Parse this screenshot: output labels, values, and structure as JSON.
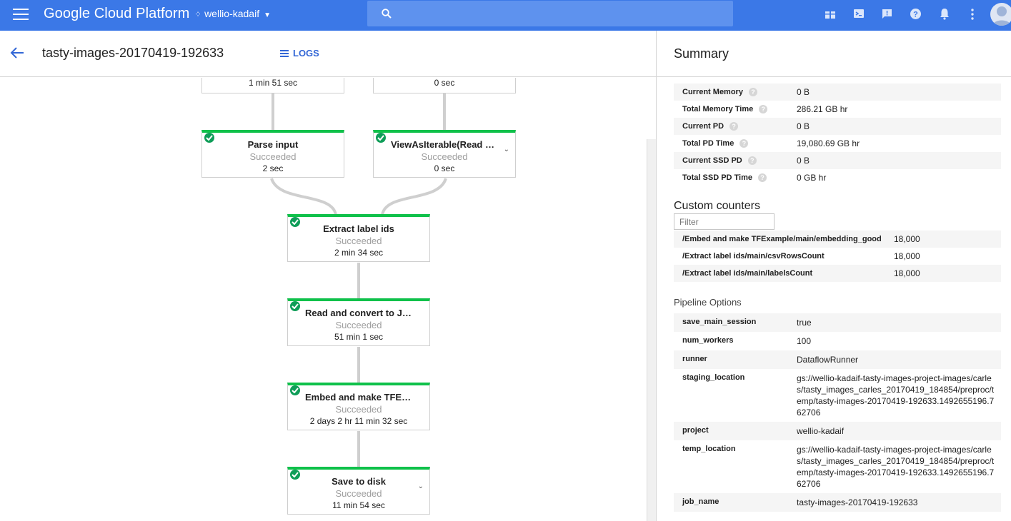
{
  "topbar": {
    "brand": "Google Cloud Platform",
    "project": "wellio-kadaif",
    "icons": [
      "gift-icon",
      "terminal-icon",
      "feedback-icon",
      "help-icon",
      "notifications-icon",
      "more-vert-icon",
      "account-avatar"
    ],
    "colors": {
      "bar": "#3b78e7",
      "search": "#5e92ee"
    }
  },
  "header": {
    "job_name": "tasty-images-20170419-192633",
    "logs_label": "LOGS"
  },
  "graph": {
    "nodes": [
      {
        "name": "",
        "status": "",
        "time": "1 min 51 sec"
      },
      {
        "name": "",
        "status": "",
        "time": "0 sec"
      },
      {
        "name": "Parse input",
        "status": "Succeeded",
        "time": "2 sec"
      },
      {
        "name": "ViewAsIterable(Read di…",
        "status": "Succeeded",
        "time": "0 sec"
      },
      {
        "name": "Extract label ids",
        "status": "Succeeded",
        "time": "2 min 34 sec"
      },
      {
        "name": "Read and convert to JP…",
        "status": "Succeeded",
        "time": "51 min 1 sec"
      },
      {
        "name": "Embed and make TFExa…",
        "status": "Succeeded",
        "time": "2 days 2 hr 11 min 32 sec"
      },
      {
        "name": "Save to disk",
        "status": "Succeeded",
        "time": "11 min 54 sec"
      }
    ],
    "success_color": "#0fc14a"
  },
  "summary": {
    "title": "Summary",
    "metrics": [
      {
        "key": "Current Memory",
        "value": "0 B"
      },
      {
        "key": "Total Memory Time",
        "value": "286.21 GB hr"
      },
      {
        "key": "Current PD",
        "value": "0 B"
      },
      {
        "key": "Total PD Time",
        "value": "19,080.69 GB hr"
      },
      {
        "key": "Current SSD PD",
        "value": "0 B"
      },
      {
        "key": "Total SSD PD Time",
        "value": "0 GB hr"
      }
    ],
    "custom_counters_title": "Custom counters",
    "filter_placeholder": "Filter",
    "counters": [
      {
        "key": "/Embed and make TFExample/main/embedding_good",
        "value": "18,000"
      },
      {
        "key": "/Extract label ids/main/csvRowsCount",
        "value": "18,000"
      },
      {
        "key": "/Extract label ids/main/labelsCount",
        "value": "18,000"
      }
    ],
    "pipeline_options_title": "Pipeline Options",
    "options": [
      {
        "key": "save_main_session",
        "value": "true"
      },
      {
        "key": "num_workers",
        "value": "100"
      },
      {
        "key": "runner",
        "value": "DataflowRunner"
      },
      {
        "key": "staging_location",
        "value": "gs://wellio-kadaif-tasty-images-project-images/carles/tasty_images_carles_20170419_184854/preproc/temp/tasty-images-20170419-192633.1492655196.762706"
      },
      {
        "key": "project",
        "value": "wellio-kadaif"
      },
      {
        "key": "temp_location",
        "value": "gs://wellio-kadaif-tasty-images-project-images/carles/tasty_images_carles_20170419_184854/preproc/temp/tasty-images-20170419-192633.1492655196.762706"
      },
      {
        "key": "job_name",
        "value": "tasty-images-20170419-192633"
      }
    ]
  }
}
